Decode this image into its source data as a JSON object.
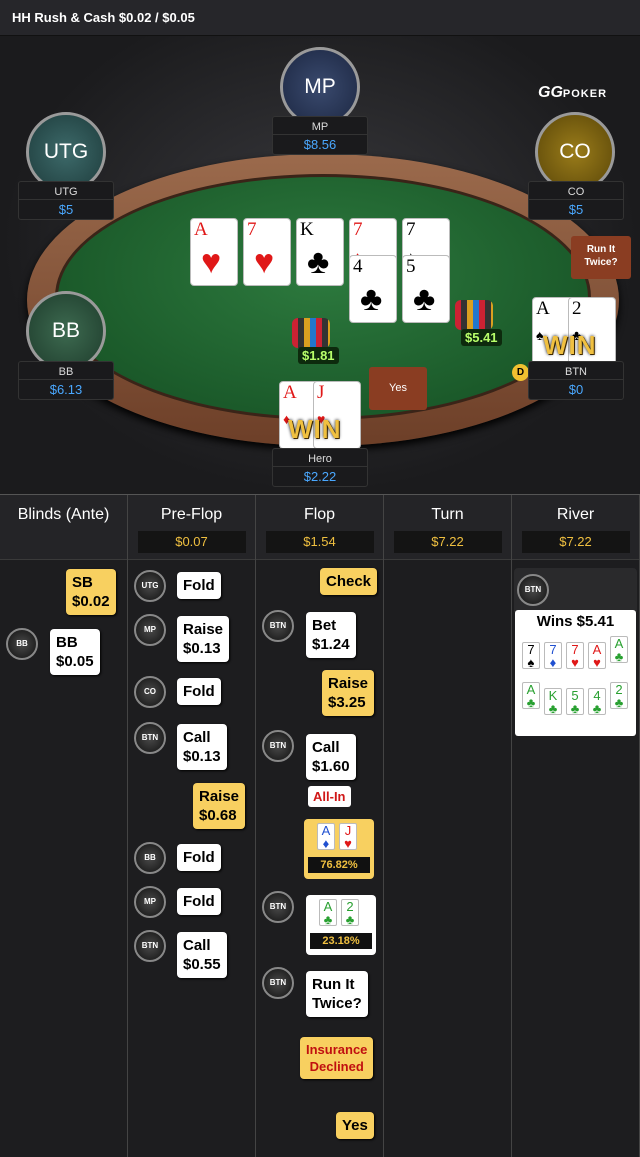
{
  "header": {
    "title": "HH  Rush & Cash $0.02 / $0.05"
  },
  "logo": {
    "brand": "GG",
    "sub": "POKER"
  },
  "seats": {
    "mp": {
      "avatar": "MP",
      "name": "MP",
      "stack": "$8.56"
    },
    "utg": {
      "avatar": "UTG",
      "name": "UTG",
      "stack": "$5"
    },
    "co": {
      "avatar": "CO",
      "name": "CO",
      "stack": "$5"
    },
    "bb": {
      "avatar": "BB",
      "name": "BB",
      "stack": "$6.13"
    },
    "btn": {
      "name": "BTN",
      "stack": "$0"
    },
    "hero": {
      "name": "Hero",
      "stack": "$2.22"
    }
  },
  "board": {
    "run1": [
      "A",
      "7",
      "K",
      "7",
      "7"
    ],
    "run2": [
      "4",
      "5"
    ]
  },
  "hero_cards": [
    "A",
    "J"
  ],
  "btn_cards": [
    "A",
    "2"
  ],
  "pots": {
    "left": "$1.81",
    "right": "$5.41"
  },
  "table_buttons": {
    "run_it_twice": "Run It Twice?",
    "yes": "Yes",
    "dealer": "D",
    "win": "WIN"
  },
  "streets": {
    "blinds": {
      "label": "Blinds (Ante)"
    },
    "preflop": {
      "label": "Pre-Flop",
      "pot": "$0.07"
    },
    "flop": {
      "label": "Flop",
      "pot": "$1.54"
    },
    "turn": {
      "label": "Turn",
      "pot": "$7.22"
    },
    "river": {
      "label": "River",
      "pot": "$7.22"
    }
  },
  "actions": {
    "sb": "SB\n$0.02",
    "bb_badge": "BB",
    "bb": "BB\n$0.05",
    "pf1_badge": "UTG",
    "pf1": "Fold",
    "pf2_badge": "MP",
    "pf2": "Raise\n$0.13",
    "pf3_badge": "CO",
    "pf3": "Fold",
    "pf4_badge": "BTN",
    "pf4": "Call\n$0.13",
    "pf5": "Raise\n$0.68",
    "pf6_badge": "BB",
    "pf6": "Fold",
    "pf7_badge": "MP",
    "pf7": "Fold",
    "pf8_badge": "BTN",
    "pf8": "Call\n$0.55",
    "f1": "Check",
    "f2_badge": "BTN",
    "f2": "Bet\n$1.24",
    "f3": "Raise\n$3.25",
    "f4_badge": "BTN",
    "f4": "Call\n$1.60",
    "allin": "All-In",
    "hero_eq": "76.82%",
    "f6_badge": "BTN",
    "btn_eq": "23.18%",
    "f7_badge": "BTN",
    "f7": "Run It\nTwice?",
    "insurance": "Insurance\nDeclined",
    "yes": "Yes"
  },
  "river_result": {
    "badge": "BTN",
    "text": "Wins $5.41",
    "row1": [
      "7",
      "7",
      "7",
      "A",
      "A"
    ],
    "row2": [
      "A",
      "K",
      "5",
      "4",
      "2"
    ]
  }
}
